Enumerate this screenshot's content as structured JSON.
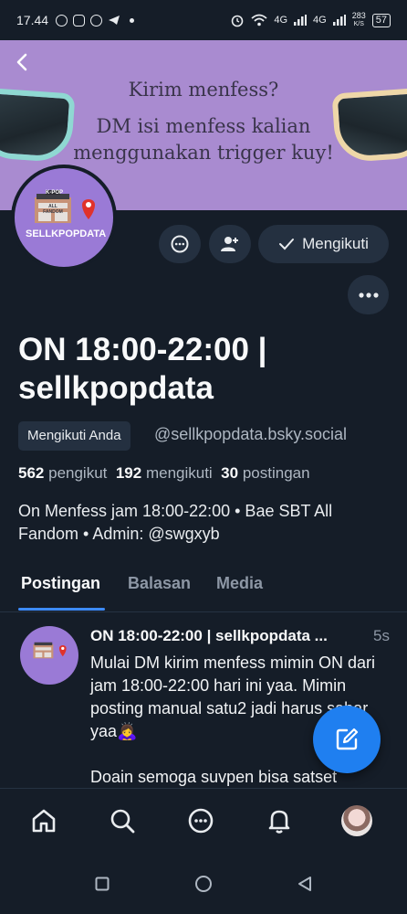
{
  "status_bar": {
    "time": "17.44",
    "net1": "4G",
    "net2": "4G",
    "speed": "283",
    "speed_unit": "K/S",
    "battery": "57"
  },
  "banner": {
    "line1": "Kirim menfess?",
    "line2": "DM isi menfess kalian menggunakan trigger kuy!"
  },
  "avatar": {
    "label_top": "K-POP",
    "label_mid": "ALL FANDOM",
    "label_name": "SELLKPOPDATA"
  },
  "actions": {
    "follow_label": "Mengikuti"
  },
  "profile": {
    "display_name": "ON 18:00-22:00 | sellkpopdata",
    "follows_you": "Mengikuti Anda",
    "handle": "@sellkpopdata.bsky.social",
    "followers_count": "562",
    "followers_label": "pengikut",
    "following_count": "192",
    "following_label": "mengikuti",
    "posts_count": "30",
    "posts_label": "postingan",
    "bio": "On Menfess jam 18:00-22:00 • Bae SBT All Fandom • Admin: @swgxyb"
  },
  "tabs": [
    {
      "label": "Postingan",
      "active": true
    },
    {
      "label": "Balasan",
      "active": false
    },
    {
      "label": "Media",
      "active": false
    }
  ],
  "post": {
    "author": "ON 18:00-22:00 | sellkpopdata ...",
    "time": "5s",
    "para1": "Mulai DM kirim menfess mimin ON dari jam 18:00-22:00 hari ini yaa. Mimin posting manual satu2 jadi harus sabar yaa🙇‍♀️",
    "para2": "Doain semoga suvpen bisa satset"
  },
  "bottom_nav": [
    "home-icon",
    "search-icon",
    "chat-icon",
    "bell-icon",
    "profile-avatar"
  ],
  "colors": {
    "background": "#151d28",
    "banner": "#a98bd0",
    "accent": "#1f7ff0",
    "button_bg": "#243040"
  }
}
